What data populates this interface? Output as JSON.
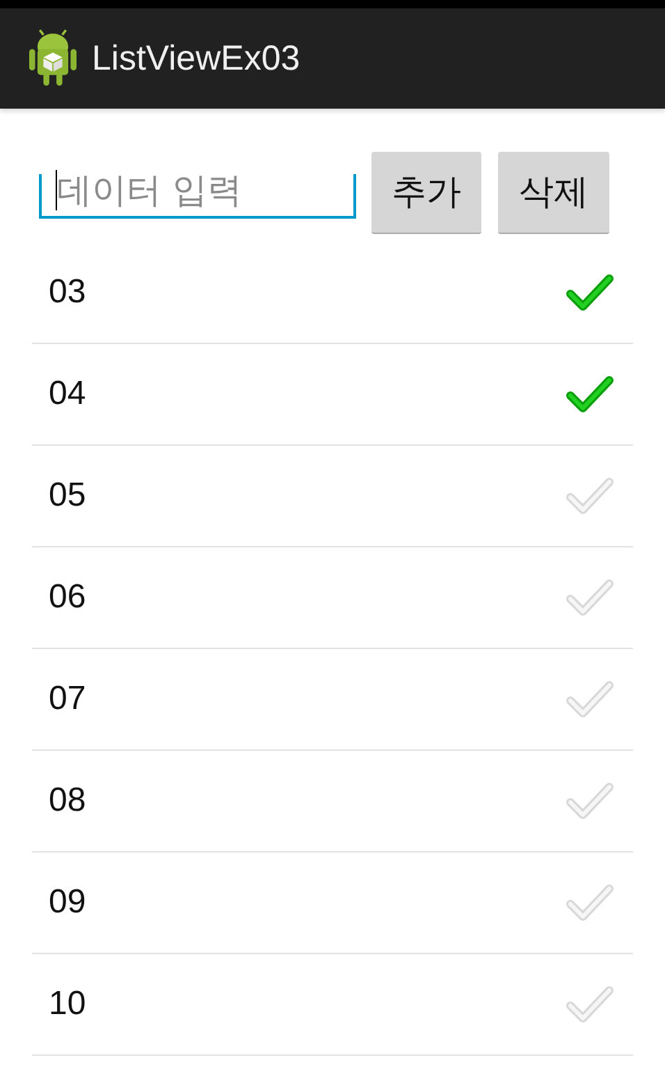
{
  "action_bar": {
    "title": "ListViewEx03"
  },
  "input": {
    "placeholder": "데이터 입력"
  },
  "buttons": [
    "추가",
    "삭제"
  ],
  "items": [
    {
      "label": "03",
      "checked": true
    },
    {
      "label": "04",
      "checked": true
    },
    {
      "label": "05",
      "checked": false
    },
    {
      "label": "06",
      "checked": false
    },
    {
      "label": "07",
      "checked": false
    },
    {
      "label": "08",
      "checked": false
    },
    {
      "label": "09",
      "checked": false
    },
    {
      "label": "10",
      "checked": false
    }
  ]
}
